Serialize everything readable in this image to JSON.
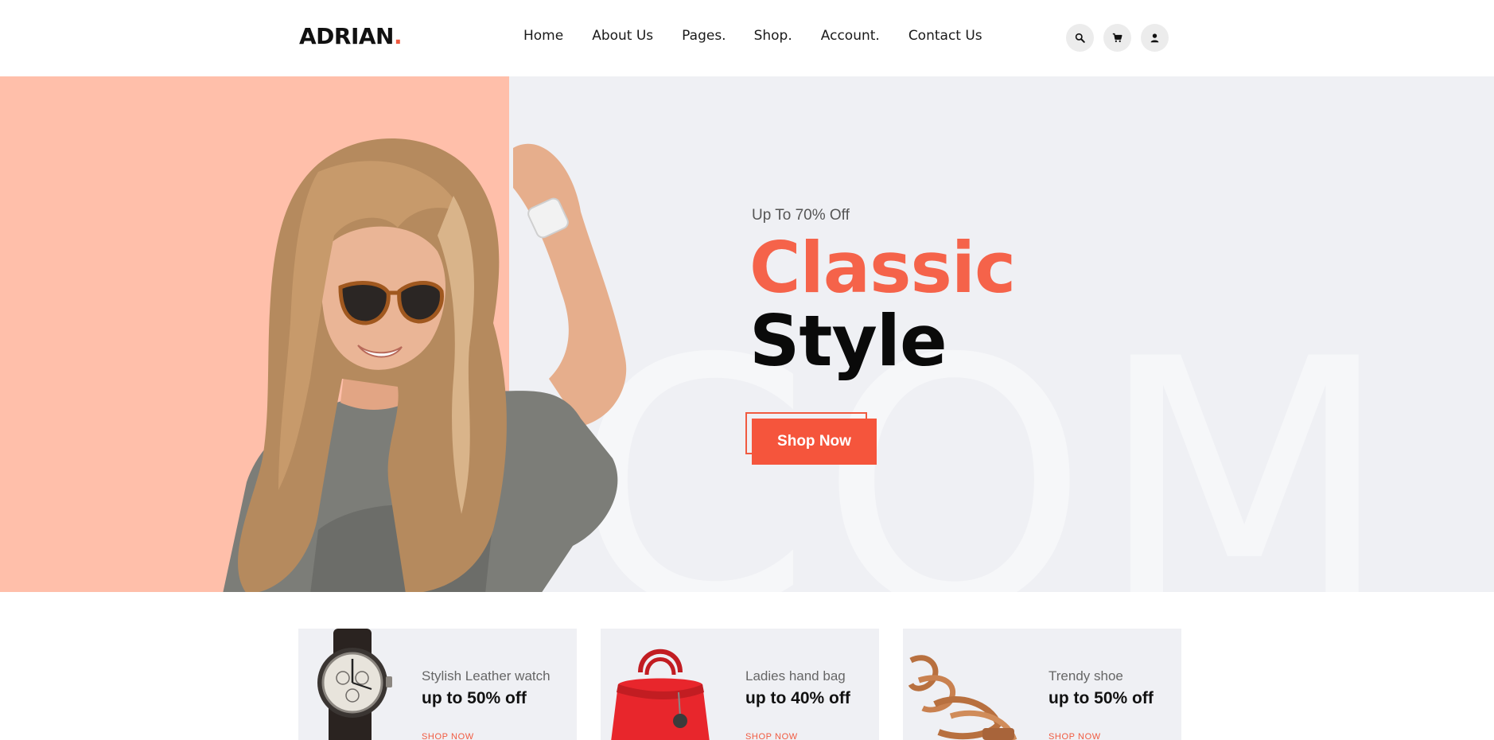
{
  "brand": {
    "name": "ADRIAN",
    "dot": ".",
    "accent": "#f05a40"
  },
  "nav": {
    "items": [
      {
        "label": "Home"
      },
      {
        "label": "About Us"
      },
      {
        "label": "Pages."
      },
      {
        "label": "Shop."
      },
      {
        "label": "Account."
      },
      {
        "label": "Contact Us"
      }
    ]
  },
  "header_icons": [
    "search-icon",
    "cart-icon",
    "user-icon"
  ],
  "hero": {
    "subtitle": "Up To 70% Off",
    "title_line1": "Classic",
    "title_line2": "Style",
    "button_label": "Shop Now",
    "watermark": "COM",
    "colors": {
      "peach": "#ffbfaa",
      "background": "#eff0f4",
      "title_accent": "#f5634a",
      "button": "#f5553c"
    }
  },
  "categories": [
    {
      "name": "Stylish Leather watch",
      "offer": "up to 50% off",
      "link": "SHOP NOW",
      "image": "watch-image"
    },
    {
      "name": "Ladies hand bag",
      "offer": "up to 40% off",
      "link": "SHOP NOW",
      "image": "handbag-image"
    },
    {
      "name": "Trendy shoe",
      "offer": "up to 50% off",
      "link": "SHOP NOW",
      "image": "shoe-image"
    }
  ]
}
